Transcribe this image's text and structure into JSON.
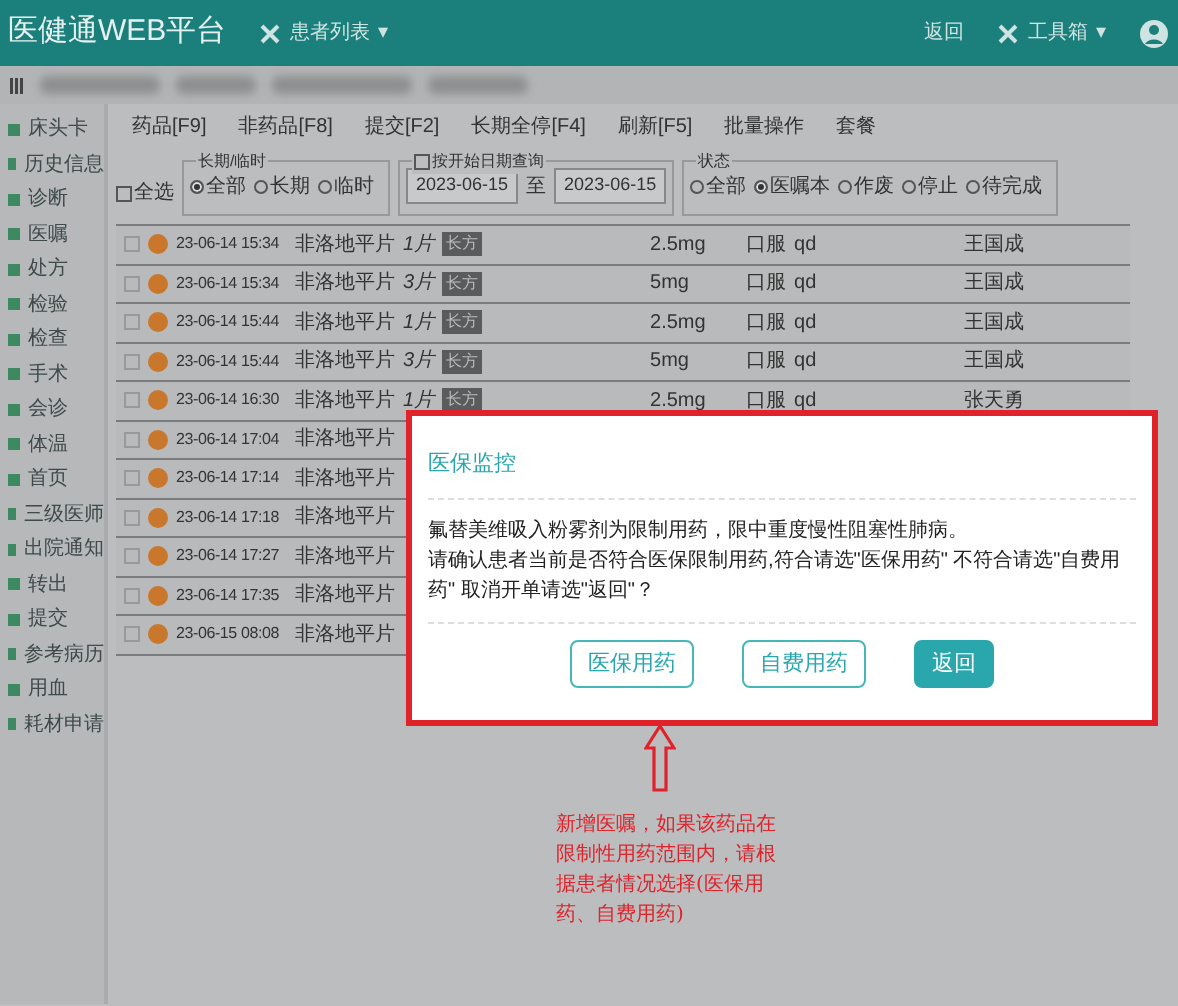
{
  "header": {
    "logo": "医健通WEB平台",
    "menu": "患者列表",
    "menu_caret": "▾",
    "back": "返回",
    "tools": "工具箱",
    "tools_caret": "▾"
  },
  "sidebar": {
    "items": [
      "床头卡",
      "历史信息",
      "诊断",
      "医嘱",
      "处方",
      "检验",
      "检查",
      "手术",
      "会诊",
      "体温",
      "首页",
      "三级医师",
      "出院通知",
      "转出",
      "提交",
      "参考病历",
      "用血",
      "耗材申请"
    ]
  },
  "toolbar": [
    "药品[F9]",
    "非药品[F8]",
    "提交[F2]",
    "长期全停[F4]",
    "刷新[F5]",
    "批量操作",
    "套餐"
  ],
  "filters": {
    "select_all": {
      "label": "全选",
      "checked": false
    },
    "term": {
      "legend": "长期/临时",
      "options": [
        {
          "label": "全部",
          "selected": true
        },
        {
          "label": "长期",
          "selected": false
        },
        {
          "label": "临时",
          "selected": false
        }
      ]
    },
    "date": {
      "legend": "按开始日期查询",
      "checked": false,
      "from": "2023-06-15",
      "sep": "至",
      "to": "2023-06-15"
    },
    "status": {
      "legend": "状态",
      "options": [
        {
          "label": "全部",
          "selected": false
        },
        {
          "label": "医嘱本",
          "selected": true
        },
        {
          "label": "作废",
          "selected": false
        },
        {
          "label": "停止",
          "selected": false
        },
        {
          "label": "待完成",
          "selected": false
        }
      ]
    }
  },
  "orders": [
    {
      "checked": false,
      "time": "23-06-14 15:34",
      "drug": "非洛地平片",
      "qty": "1片",
      "tag": "长方",
      "dose": "2.5mg",
      "route": "口服",
      "freq": "qd",
      "doctor": "王国成"
    },
    {
      "checked": false,
      "time": "23-06-14 15:34",
      "drug": "非洛地平片",
      "qty": "3片",
      "tag": "长方",
      "dose": "5mg",
      "route": "口服",
      "freq": "qd",
      "doctor": "王国成"
    },
    {
      "checked": false,
      "time": "23-06-14 15:44",
      "drug": "非洛地平片",
      "qty": "1片",
      "tag": "长方",
      "dose": "2.5mg",
      "route": "口服",
      "freq": "qd",
      "doctor": "王国成"
    },
    {
      "checked": false,
      "time": "23-06-14 15:44",
      "drug": "非洛地平片",
      "qty": "3片",
      "tag": "长方",
      "dose": "5mg",
      "route": "口服",
      "freq": "qd",
      "doctor": "王国成"
    },
    {
      "checked": false,
      "time": "23-06-14 16:30",
      "drug": "非洛地平片",
      "qty": "1片",
      "tag": "长方",
      "dose": "2.5mg",
      "route": "口服",
      "freq": "qd",
      "doctor": "张天勇"
    },
    {
      "checked": false,
      "time": "23-06-14 17:04",
      "drug": "非洛地平片"
    },
    {
      "checked": false,
      "time": "23-06-14 17:14",
      "drug": "非洛地平片"
    },
    {
      "checked": false,
      "time": "23-06-14 17:18",
      "drug": "非洛地平片"
    },
    {
      "checked": false,
      "time": "23-06-14 17:27",
      "drug": "非洛地平片"
    },
    {
      "checked": false,
      "time": "23-06-14 17:35",
      "drug": "非洛地平片"
    },
    {
      "checked": false,
      "time": "23-06-15 08:08",
      "drug": "非洛地平片"
    }
  ],
  "dialog": {
    "title": "医保监控",
    "lines": [
      "氟替美维吸入粉雾剂为限制用药，限中重度慢性阻塞性肺病。",
      "请确认患者当前是否符合医保限制用药,符合请选\"医保用药\" 不符合请选\"自费用药\" 取消开单请选\"返回\"？"
    ],
    "buttons": [
      {
        "label": "医保用药",
        "kind": "outline"
      },
      {
        "label": "自费用药",
        "kind": "outline"
      },
      {
        "label": "返回",
        "kind": "primary"
      }
    ]
  },
  "annotation": "新增医嘱，如果该药品在限制性用药范围内，请根据患者情况选择(医保用药、自费用药)"
}
